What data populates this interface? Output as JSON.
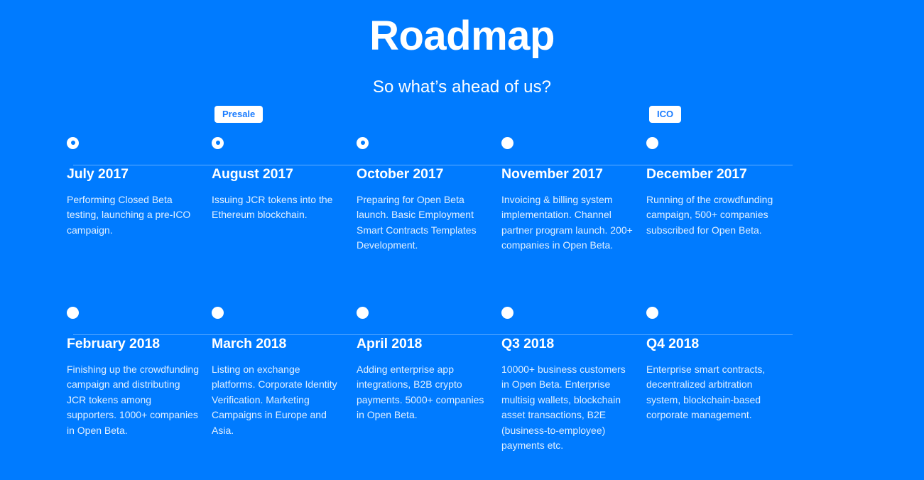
{
  "theme": {
    "background": "#007bff",
    "text": "#ffffff",
    "badge_background": "#ffffff",
    "badge_text": "#1a7cff",
    "line": "rgba(255,255,255,0.38)"
  },
  "header": {
    "title": "Roadmap",
    "subtitle": "So what’s ahead of us?"
  },
  "timeline": {
    "rows": [
      {
        "items": [
          {
            "badge": "",
            "marker": "donut",
            "date": "July 2017",
            "description": "Performing Closed Beta testing, launching a pre-ICO campaign."
          },
          {
            "badge": "Presale",
            "marker": "donut",
            "date": "August 2017",
            "description": "Issuing JCR tokens into the Ethereum blockchain."
          },
          {
            "badge": "",
            "marker": "donut",
            "date": "October 2017",
            "description": "Preparing for Open Beta launch. Basic Employment Smart Contracts Templates Development."
          },
          {
            "badge": "",
            "marker": "solid",
            "date": "November 2017",
            "description": "Invoicing & billing system implementation. Channel partner program launch. 200+ companies in Open Beta."
          },
          {
            "badge": "ICO",
            "marker": "solid",
            "date": "December 2017",
            "description": "Running of the crowdfunding campaign, 500+ companies subscribed for Open Beta."
          }
        ]
      },
      {
        "items": [
          {
            "badge": "",
            "marker": "solid",
            "date": "February 2018",
            "description": "Finishing up the crowdfunding campaign and distributing JCR tokens among supporters. 1000+ companies in Open Beta."
          },
          {
            "badge": "",
            "marker": "solid",
            "date": "March 2018",
            "description": "Listing on exchange platforms. Corporate Identity Verification. Marketing Campaigns in Europe and Asia."
          },
          {
            "badge": "",
            "marker": "solid",
            "date": "April 2018",
            "description": "Adding enterprise app integrations, B2B crypto payments. 5000+ companies in Open Beta."
          },
          {
            "badge": "",
            "marker": "solid",
            "date": "Q3 2018",
            "description": "10000+ business customers in Open Beta. Enterprise multisig wallets, blockchain asset transactions, B2E (business-to-employee) payments etc."
          },
          {
            "badge": "",
            "marker": "solid",
            "date": "Q4 2018",
            "description": "Enterprise smart contracts, decentralized arbitration system, blockchain-based corporate management."
          }
        ]
      }
    ]
  }
}
